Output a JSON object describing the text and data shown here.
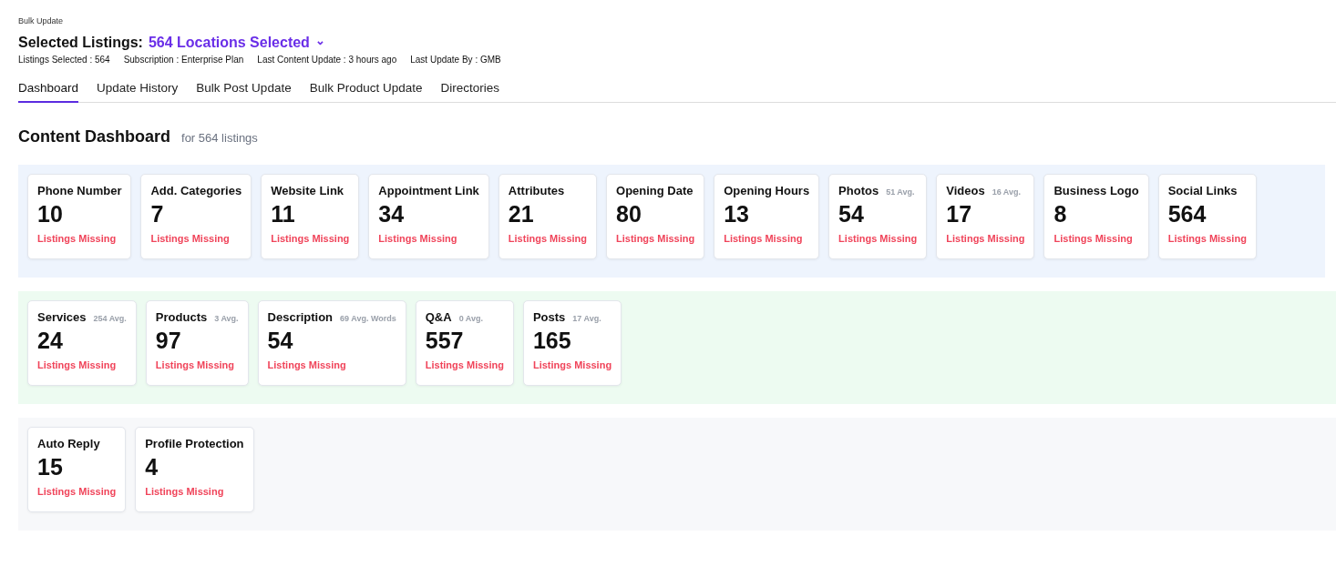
{
  "breadcrumb": "Bulk Update",
  "title": {
    "label": "Selected Listings:",
    "value": "564 Locations Selected",
    "caret": "⌄"
  },
  "meta": [
    "Listings Selected : 564",
    "Subscription : Enterprise Plan",
    "Last Content Update : 3 hours ago",
    "Last Update By : GMB"
  ],
  "tabs": [
    {
      "label": "Dashboard",
      "selected": true
    },
    {
      "label": "Update History",
      "selected": false
    },
    {
      "label": "Bulk Post Update",
      "selected": false
    },
    {
      "label": "Bulk Product Update",
      "selected": false
    },
    {
      "label": "Directories",
      "selected": false
    }
  ],
  "heading": {
    "title": "Content Dashboard",
    "subtitle": "for 564 listings"
  },
  "sections": [
    {
      "color": "#eef4fd",
      "cards": [
        {
          "title": "Phone Number",
          "count": "10",
          "status": "Listings Missing"
        },
        {
          "title": "Add. Categories",
          "count": "7",
          "status": "Listings Missing"
        },
        {
          "title": "Website Link",
          "count": "11",
          "status": "Listings Missing"
        },
        {
          "title": "Appointment Link",
          "count": "34",
          "status": "Listings Missing"
        },
        {
          "title": "Attributes",
          "count": "21",
          "status": "Listings Missing"
        },
        {
          "title": "Opening Date",
          "count": "80",
          "status": "Listings Missing"
        },
        {
          "title": "Opening Hours",
          "count": "13",
          "status": "Listings Missing"
        },
        {
          "title": "Photos",
          "avg": "51 Avg.",
          "count": "54",
          "status": "Listings Missing"
        },
        {
          "title": "Videos",
          "avg": "16 Avg.",
          "count": "17",
          "status": "Listings Missing"
        },
        {
          "title": "Business Logo",
          "count": "8",
          "status": "Listings Missing"
        },
        {
          "title": "Social Links",
          "count": "564",
          "status": "Listings Missing"
        }
      ]
    },
    {
      "color": "#edfbf1",
      "cards": [
        {
          "title": "Services",
          "avg": "254 Avg.",
          "count": "24",
          "status": "Listings Missing"
        },
        {
          "title": "Products",
          "avg": "3 Avg.",
          "count": "97",
          "status": "Listings Missing"
        },
        {
          "title": "Description",
          "avg": "69 Avg. Words",
          "count": "54",
          "status": "Listings Missing"
        },
        {
          "title": "Q&A",
          "avg": "0 Avg.",
          "count": "557",
          "status": "Listings Missing"
        },
        {
          "title": "Posts",
          "avg": "17 Avg.",
          "count": "165",
          "status": "Listings Missing"
        }
      ]
    },
    {
      "color": "#f7f8fa",
      "cards": [
        {
          "title": "Auto Reply",
          "count": "15",
          "status": "Listings Missing"
        },
        {
          "title": "Profile Protection",
          "count": "4",
          "status": "Listings Missing"
        }
      ]
    }
  ]
}
